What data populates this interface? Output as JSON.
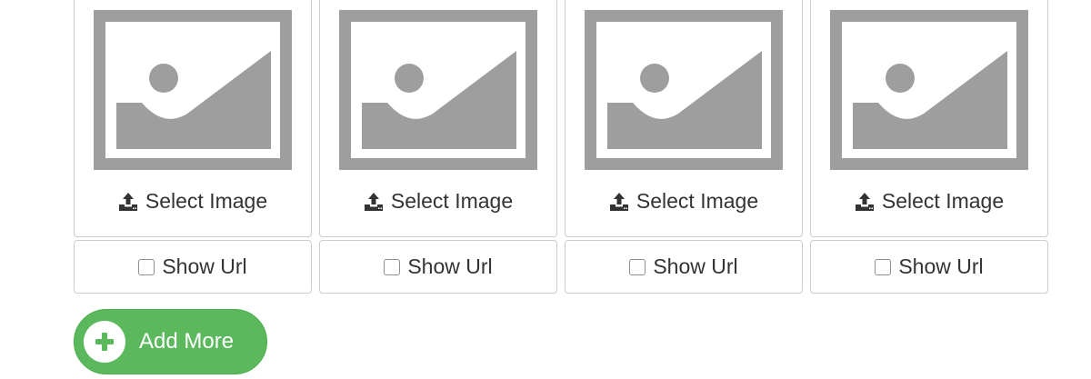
{
  "image_cards": [
    {
      "select_label": "Select Image",
      "show_url_label": "Show Url",
      "show_url_checked": false
    },
    {
      "select_label": "Select Image",
      "show_url_label": "Show Url",
      "show_url_checked": false
    },
    {
      "select_label": "Select Image",
      "show_url_label": "Show Url",
      "show_url_checked": false
    },
    {
      "select_label": "Select Image",
      "show_url_label": "Show Url",
      "show_url_checked": false
    }
  ],
  "icons": {
    "placeholder": "image-placeholder-icon",
    "upload": "upload-icon",
    "add": "plus-icon"
  },
  "add_more_button": {
    "label": "Add More"
  },
  "colors": {
    "placeholder_gray": "#9e9e9e",
    "border": "#cccccc",
    "success_green": "#5cb85c",
    "text": "#333333"
  }
}
